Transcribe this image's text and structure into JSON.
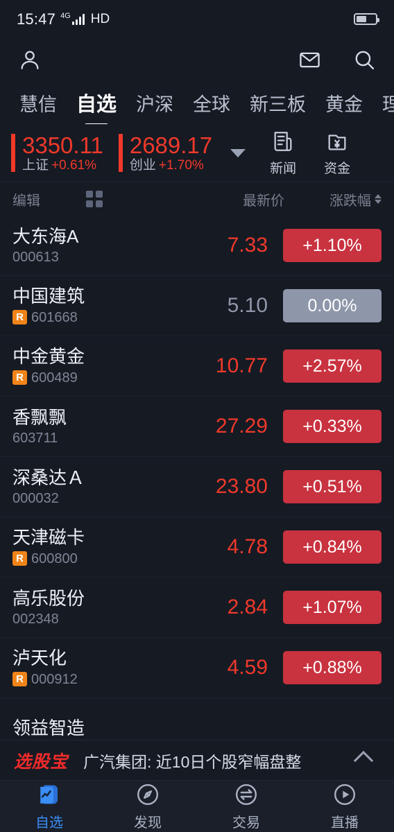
{
  "status_bar": {
    "time": "15:47",
    "network": "4G",
    "call_type": "HD"
  },
  "header": {
    "profile_icon": "person-icon",
    "mail_icon": "mail-icon",
    "search_icon": "search-icon"
  },
  "tabs": [
    {
      "label": "慧信",
      "active": false
    },
    {
      "label": "自选",
      "active": true
    },
    {
      "label": "沪深",
      "active": false
    },
    {
      "label": "全球",
      "active": false
    },
    {
      "label": "新三板",
      "active": false
    },
    {
      "label": "黄金",
      "active": false
    },
    {
      "label": "理财",
      "active": false
    }
  ],
  "indices": [
    {
      "value": "3350.11",
      "name": "上证",
      "change": "+0.61%"
    },
    {
      "value": "2689.17",
      "name": "创业",
      "change": "+1.70%"
    }
  ],
  "quick_actions": [
    {
      "label": "新闻",
      "icon": "news-icon"
    },
    {
      "label": "资金",
      "icon": "funds-icon"
    }
  ],
  "list_header": {
    "edit": "编辑",
    "grid_icon": "grid-icon",
    "price": "最新价",
    "change": "涨跌幅",
    "sort_icon": "sort-arrows-icon"
  },
  "stocks": [
    {
      "name": "大东海A",
      "code": "000613",
      "flag": "",
      "price": "7.33",
      "change": "+1.10%",
      "dir": "up"
    },
    {
      "name": "中国建筑",
      "code": "601668",
      "flag": "R",
      "price": "5.10",
      "change": "0.00%",
      "dir": "flat"
    },
    {
      "name": "中金黄金",
      "code": "600489",
      "flag": "R",
      "price": "10.77",
      "change": "+2.57%",
      "dir": "up"
    },
    {
      "name": "香飘飘",
      "code": "603711",
      "flag": "",
      "price": "27.29",
      "change": "+0.33%",
      "dir": "up"
    },
    {
      "name": "深桑达Ａ",
      "code": "000032",
      "flag": "",
      "price": "23.80",
      "change": "+0.51%",
      "dir": "up"
    },
    {
      "name": "天津磁卡",
      "code": "600800",
      "flag": "R",
      "price": "4.78",
      "change": "+0.84%",
      "dir": "up"
    },
    {
      "name": "高乐股份",
      "code": "002348",
      "flag": "",
      "price": "2.84",
      "change": "+1.07%",
      "dir": "up"
    },
    {
      "name": "泸天化",
      "code": "000912",
      "flag": "R",
      "price": "4.59",
      "change": "+0.88%",
      "dir": "up"
    },
    {
      "name": "领益智造",
      "code": "",
      "flag": "",
      "price": "",
      "change": "",
      "dir": "up"
    }
  ],
  "promo": {
    "logo": "选股宝",
    "text": "广汽集团: 近10日个股窄幅盘整",
    "collapse_icon": "chevron-up-icon"
  },
  "bottom_nav": [
    {
      "label": "自选",
      "icon": "watchlist-icon",
      "active": true
    },
    {
      "label": "发现",
      "icon": "compass-icon",
      "active": false
    },
    {
      "label": "交易",
      "icon": "exchange-icon",
      "active": false
    },
    {
      "label": "直播",
      "icon": "play-icon",
      "active": false
    }
  ],
  "colors": {
    "background": "#161a23",
    "up_red": "#f0392b",
    "badge_red": "#c9323f",
    "flat_gray": "#8e96aa",
    "accent_blue": "#3a8ef6",
    "flag_orange": "#f08419"
  }
}
